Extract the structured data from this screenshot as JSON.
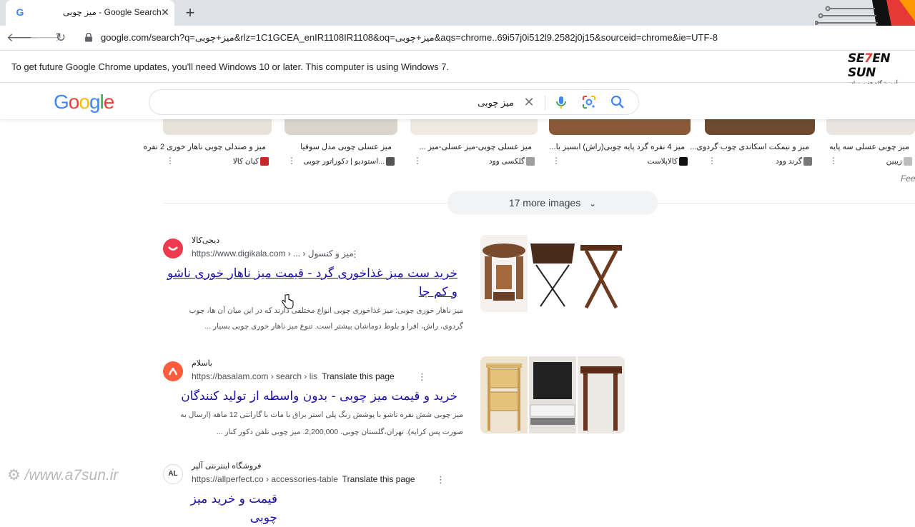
{
  "browser": {
    "tab_title": "میز چوبی - Google Search",
    "tab_favicon": "G",
    "url": "google.com/search?q=میز+چوبی&rlz=1C1GCEA_enIR1108IR1108&oq=میز+چوبی&aqs=chrome..69i57j0i512l9.2582j0j15&sourceid=chrome&ie=UTF-8",
    "infobar_message": "To get future Google Chrome updates, you'll need Windows 10 or later. This computer is using Windows 7."
  },
  "brand": {
    "part1": "SE",
    "seven": "7",
    "part2": "EN SUN",
    "tagline": "آموزشگاه هفت سان"
  },
  "search": {
    "query": "میز چوبی",
    "logo_letters": [
      {
        "ch": "G",
        "color": "#4285f4"
      },
      {
        "ch": "o",
        "color": "#ea4335"
      },
      {
        "ch": "o",
        "color": "#fbbc05"
      },
      {
        "ch": "g",
        "color": "#4285f4"
      },
      {
        "ch": "l",
        "color": "#34a853"
      },
      {
        "ch": "e",
        "color": "#ea4335"
      }
    ]
  },
  "image_strip": [
    {
      "caption": "میز و صندلی چوبی ناهار خوری 2 نفره",
      "source": "کیان کالا"
    },
    {
      "caption": "میز عسلی چوبی مدل سوفیا",
      "source": "...استودیو | دکوراتور چوبی"
    },
    {
      "caption": "میز عسلی چوبی-میز عسلی-میز ...",
      "source": "گلکسی وود"
    },
    {
      "caption": "میز 4 نفره گرد پایه چوبی(راش) ابسیز با...",
      "source": "کالاپلاست"
    },
    {
      "caption": "میز و نیمکت اسکاندی چوب گردوی...",
      "source": "گرند وود"
    },
    {
      "caption": "میز چوبی عسلی سه پایه",
      "source": "زیبین"
    }
  ],
  "feedback_partial": "Fee",
  "more_images_label": "17 more images",
  "results": [
    {
      "site_name": "دیجی‌کالا",
      "cite": "https://www.digikala.com › ... › میز و کنسول",
      "translate": "",
      "title": "خرید ست میز غذاخوری گرد - قیمت میز ناهار خوری ناشو و کم جا",
      "snippet_1": "میز ناهار خوری چوبی: میز غذاخوری چوبی انواع مختلفی دارند که در این میان آن ها، چوب",
      "snippet_2": "گردوی، راش، افرا و بلوط دوماشان بیشتر است. تنوع میز ناهار خوری چوبی بسیار ..."
    },
    {
      "site_name": "باسلام",
      "cite": "https://basalam.com › search › lis",
      "translate": "Translate this page",
      "title": "خرید و قیمت میز چوبی - بدون واسطه از تولید کنندگان",
      "snippet_1": "میز چوبی شش نفره تاشو با پوشش رنگ پلی استر براق با مات با گارانتی 12 ماهه (ارسال به",
      "snippet_2": "صورت پس کرایه). تهران،گلستان چوبی. 2,200,000. میز چوبی تلفن دکور کنار ..."
    },
    {
      "site_name": "فروشگاه اینترنتی آلپر",
      "cite": "https://allperfect.co › accessories-table",
      "translate": "Translate this page",
      "title": "قیمت و خرید میز چوبی",
      "snippet_1": "",
      "snippet_2": ""
    }
  ],
  "watermark": "/www.a7sun.ir",
  "colors": {
    "link_visited": "#681da8",
    "link": "#1a0dab",
    "title_dark": "#1a0dab",
    "digikala_red": "#ef394e",
    "basalam_orange": "#ff5c3d"
  }
}
